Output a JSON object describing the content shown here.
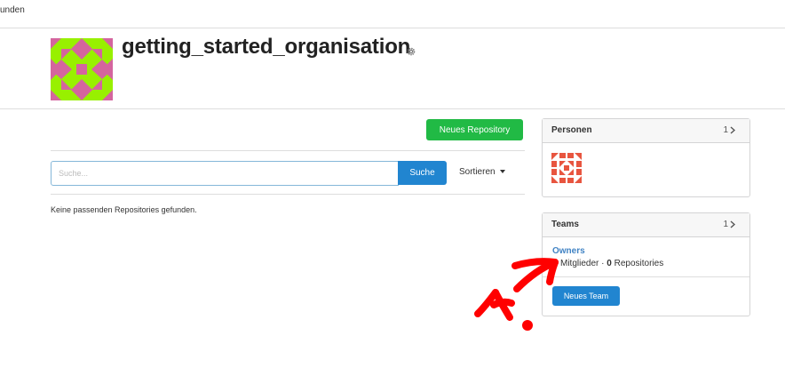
{
  "topbar": {
    "crumb": "unden"
  },
  "org": {
    "name": "getting_started_organisation"
  },
  "actions": {
    "new_repo_label": "Neues Repository"
  },
  "search": {
    "placeholder": "Suche...",
    "button_label": "Suche",
    "sort_label": "Sortieren"
  },
  "repos": {
    "empty_message": "Keine passenden Repositories gefunden."
  },
  "people": {
    "title": "Personen",
    "count": "1"
  },
  "teams": {
    "title": "Teams",
    "count": "1",
    "items": [
      {
        "name": "Owners",
        "members_label": "Mitglieder",
        "separator": "·",
        "repos_count": "0",
        "repos_label": "Repositories"
      }
    ],
    "new_team_label": "Neues Team"
  },
  "colors": {
    "green": "#21ba45",
    "blue": "#2185d0",
    "link": "#4183c4",
    "annotation": "#ff0000",
    "identicon_green": "#98f000",
    "identicon_pink": "#d4659e",
    "identicon_red": "#e8553f"
  },
  "icons": {
    "settings": "gear-icon",
    "people_chevron": "chevron-right-icon",
    "teams_chevron": "chevron-right-icon",
    "sort_caret": "caret-down-icon"
  }
}
